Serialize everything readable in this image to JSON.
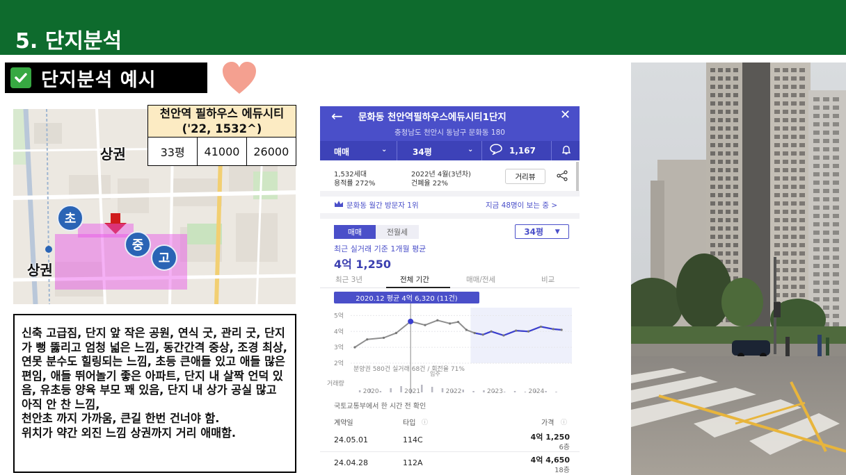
{
  "slide": {
    "title": "5. 단지분석",
    "subtitle": "단지분석 예시",
    "colors": {
      "header_green": "#0e6b2d",
      "check_green": "#37a842",
      "heart": "#f4a090",
      "app_blue": "#4a4fc9"
    }
  },
  "map": {
    "labels": {
      "commercial_top": "상권",
      "commercial_left": "상권"
    },
    "badges": {
      "elementary": "초",
      "middle": "중",
      "high": "고"
    }
  },
  "info_table": {
    "name": "천안역 필하우스 에듀시티",
    "meta": "('22, 1532^)",
    "size": "33평",
    "price_sale": "41000",
    "price_jeonse": "26000"
  },
  "description": {
    "lines": [
      "신축 고급짐, 단지 앞 작은 공원, 연식 굿, 관리 굿, 단지가 뻥 뚫리고 엄청 넓은 느낌, 동간간격 중상, 조경 최상, 연못 분수도 힐링되는 느낌, 초등 큰애들 있고 애들 많은 편임, 애들 뛰어놀기 좋은 아파트, 단지 내 살짝 언덕 있음, 유초등 양육 부모 꽤 있음, 단지 내 상가 공실 많고 아직 안 찬 느낌,",
      "천안초 까지 가까움, 큰길 한번 건너야 함.",
      "위치가 약간 외진 느낌 상권까지 거리 애매함."
    ]
  },
  "app": {
    "title": "문화동 천안역필하우스에듀시티1단지",
    "address": "충청남도 천안시 동남구 문화동 180",
    "filters": {
      "trade": "매매",
      "size": "34평",
      "comments": "1,167"
    },
    "summary": {
      "households": "1,532세대",
      "floor_ratio": "용적률 272%",
      "built": "2022년 4월(3년차)",
      "coverage": "건폐율 22%",
      "street_view": "거리뷰"
    },
    "visit": {
      "rank": "문화동 월간 방문자 1위",
      "viewers": "지금 48명이 보는 중 >"
    },
    "tabs": {
      "sale": "매매",
      "rent": "전월세"
    },
    "size_select": "34평",
    "price_caption": "최근 실거래 기준 1개월 평균",
    "price_value": "4억 1,250",
    "periods": [
      "최근 3년",
      "전체 기간",
      "매매/전세",
      "비교"
    ],
    "tooltip": "2020.12 평균 4억 6,320 (11건)",
    "chart_note": "분양권 580건 실거래 68건 / 회전율 71%",
    "move_in": "입주",
    "volume_label": "거래량",
    "source": "국토교통부에서 한 시간 전 확인",
    "table": {
      "headers": {
        "date": "계약일",
        "type": "타입",
        "price": "가격"
      },
      "rows": [
        {
          "date": "24.05.01",
          "type": "114C",
          "price": "4억 1,250",
          "floor": "6층"
        },
        {
          "date": "24.04.28",
          "type": "112A",
          "price": "4억 4,650",
          "floor": "18층"
        }
      ]
    }
  },
  "chart_data": {
    "type": "line",
    "title": "",
    "xlabel": "",
    "ylabel": "",
    "x_ticks": [
      "2020",
      "2021",
      "2022",
      "2023",
      "2024"
    ],
    "y_ticks": [
      "5억",
      "4억",
      "3억",
      "2억"
    ],
    "ylim": [
      2,
      5.5
    ],
    "series": [
      {
        "x": [
          2019.6,
          2019.9,
          2020.3,
          2020.6,
          2020.95,
          2021.3,
          2021.6,
          2021.9,
          2022.1,
          2022.3,
          2022.5,
          2022.7,
          2022.9,
          2023.2,
          2023.5,
          2023.8,
          2024.1,
          2024.4,
          2024.6
        ],
        "y": [
          3.0,
          3.5,
          3.6,
          3.9,
          4.63,
          4.4,
          4.7,
          4.5,
          4.6,
          4.1,
          3.9,
          3.8,
          4.0,
          3.75,
          4.05,
          4.0,
          4.3,
          4.15,
          4.1
        ]
      }
    ]
  }
}
